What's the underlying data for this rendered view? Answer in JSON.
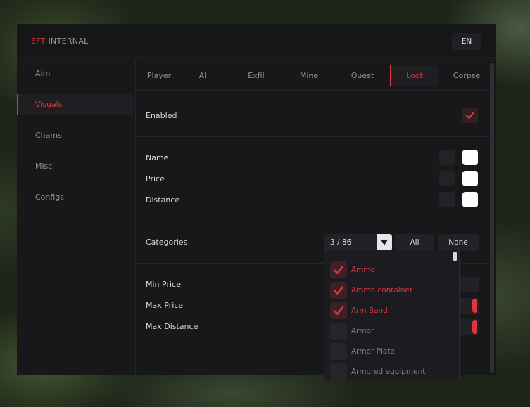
{
  "brand": {
    "part1": "EFT",
    "part2": "INTERNAL"
  },
  "language": "EN",
  "sidebar": {
    "items": [
      {
        "label": "Aim",
        "active": false
      },
      {
        "label": "Visuals",
        "active": true
      },
      {
        "label": "Chams",
        "active": false
      },
      {
        "label": "Misc",
        "active": false
      },
      {
        "label": "Configs",
        "active": false
      }
    ]
  },
  "tabs": [
    {
      "label": "Player",
      "active": false
    },
    {
      "label": "AI",
      "active": false
    },
    {
      "label": "Exfil",
      "active": false
    },
    {
      "label": "Mine",
      "active": false
    },
    {
      "label": "Quest",
      "active": false
    },
    {
      "label": "Loot",
      "active": true
    },
    {
      "label": "Corpse",
      "active": false
    }
  ],
  "settings": {
    "enabled": {
      "label": "Enabled",
      "checked": true
    },
    "name": {
      "label": "Name",
      "color": "#ffffff"
    },
    "price": {
      "label": "Price",
      "color": "#ffffff"
    },
    "distance": {
      "label": "Distance",
      "color": "#ffffff"
    },
    "categories": {
      "label": "Categories",
      "selected": "3 / 86",
      "all_label": "All",
      "none_label": "None"
    },
    "min_price": {
      "label": "Min Price"
    },
    "max_price": {
      "label": "Max Price"
    },
    "max_distance": {
      "label": "Max Distance"
    }
  },
  "category_options": [
    {
      "label": "Ammo",
      "checked": true
    },
    {
      "label": "Ammo container",
      "checked": true
    },
    {
      "label": "Arm Band",
      "checked": true
    },
    {
      "label": "Armor",
      "checked": false
    },
    {
      "label": "Armor Plate",
      "checked": false
    },
    {
      "label": "Armored equipment",
      "checked": false
    }
  ],
  "colors": {
    "accent": "#e0353c",
    "panel": "#18181b",
    "text": "#d8d8dc",
    "muted": "#8e8e94"
  }
}
